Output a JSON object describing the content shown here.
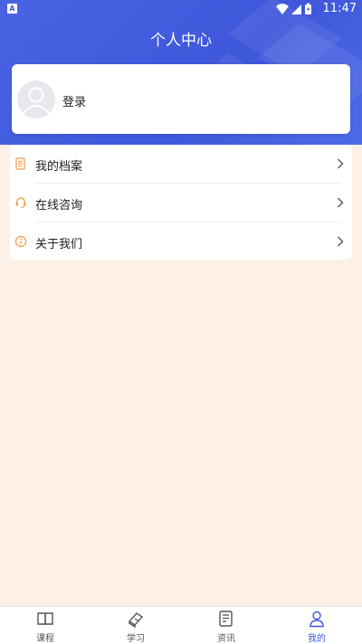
{
  "status_bar": {
    "notification_badge": "A",
    "time": "11:47",
    "icons": [
      "wifi-icon",
      "signal-icon",
      "battery-icon"
    ]
  },
  "header": {
    "title": "个人中心"
  },
  "profile": {
    "login_label": "登录"
  },
  "menu": {
    "items": [
      {
        "label": "我的档案",
        "icon": "document-icon"
      },
      {
        "label": "在线咨询",
        "icon": "headset-icon"
      },
      {
        "label": "关于我们",
        "icon": "info-icon"
      }
    ]
  },
  "tabbar": {
    "tabs": [
      {
        "label": "课程",
        "icon": "book-icon"
      },
      {
        "label": "学习",
        "icon": "textbook-icon"
      },
      {
        "label": "资讯",
        "icon": "news-icon"
      },
      {
        "label": "我的",
        "icon": "person-icon",
        "active": true
      }
    ]
  },
  "colors": {
    "primary": "#3F57DA",
    "page_background": "#FDF0E7",
    "menu_icon_accent": "#F0A04B"
  }
}
